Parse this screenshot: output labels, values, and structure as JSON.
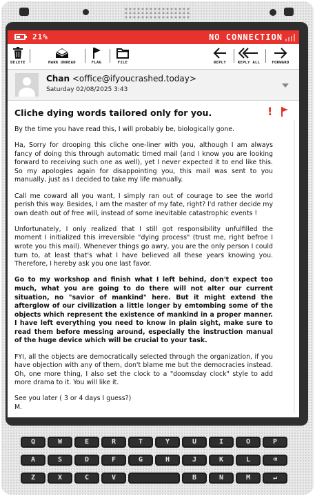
{
  "status": {
    "battery": "21%",
    "connection": "NO CONNECTION"
  },
  "toolbar": {
    "delete": "DELETE",
    "mark_unread": "MARK UNREAD",
    "flag": "FLAG",
    "file": "FILE",
    "reply": "REPLY",
    "reply_all": "REPLY ALL",
    "forward": "FORWARD"
  },
  "message": {
    "sender_name": "Chan",
    "sender_email": "<office@ifyoucrashed.today>",
    "date": "Saturday 02/08/2025  3:43",
    "subject": "Cliche dying words tailored only for you.",
    "importance": "!",
    "paragraphs": [
      "By the time you have read this, I will probably be, biologically gone.",
      "Ha, Sorry for drooping this cliche one-liner with you, although I am always fancy of doing this through automatic timed mail (and I know you are looking forward to receiving such one as well), yet I never expected it to end like this. So my apologies again for disappointing you, this mail was sent to you manually, just as I decided to take my life manually.",
      "Call me coward all you want, I simply ran out of courage to see the world perish this way. Besides, I am the master of my fate, right? I'd rather decide my own death out of free will, instead of some inevitable catastrophic events !",
      "Unfortunately, I only realized that I still got responsibility unfulfilled the moment I initialized this irreversible \"dying process\" (trust me, right befroe I wrote you this mail). Whenever things go awry, you are the only person I could turn to, at least that's what I have believed all these years knowing you. Therefore, I hereby ask you one last favor.",
      "Go to my workshop and finish what I left behind, don't expect too much, what you are going to do there will not alter our current situation, no \"savior of mankind\" here. But it might extend the afterglow of our civilization a little longer by emtombing some of the objects which represent the existence of mankind in a proper manner. I have left everything you need to know in plain sight, make sure to read them before messing around, especially the instruction manual of the huge device which will be crucial to your task.",
      "FYI, all the objects are democratically selected through the organization, if you have objection with any of them, don't blame me but the democracies instead. Oh, one more thing, I also set the clock to a \"doomsday clock\" style to add more drama to it. You will like it.",
      "See you later ( 3 or 4 days I guess?)",
      "M."
    ]
  },
  "keyboard": {
    "row1": [
      "Q",
      "W",
      "E",
      "R",
      "T",
      "Y",
      "U",
      "I",
      "O",
      "P"
    ],
    "row2": [
      "A",
      "S",
      "D",
      "F",
      "G",
      "H",
      "J",
      "K",
      "L",
      "⌫"
    ],
    "row3": [
      "Z",
      "X",
      "C",
      "V",
      "",
      "B",
      "N",
      "M",
      "↵"
    ]
  },
  "colors": {
    "accent": "#e8322d",
    "frame": "#2e2e2e"
  }
}
